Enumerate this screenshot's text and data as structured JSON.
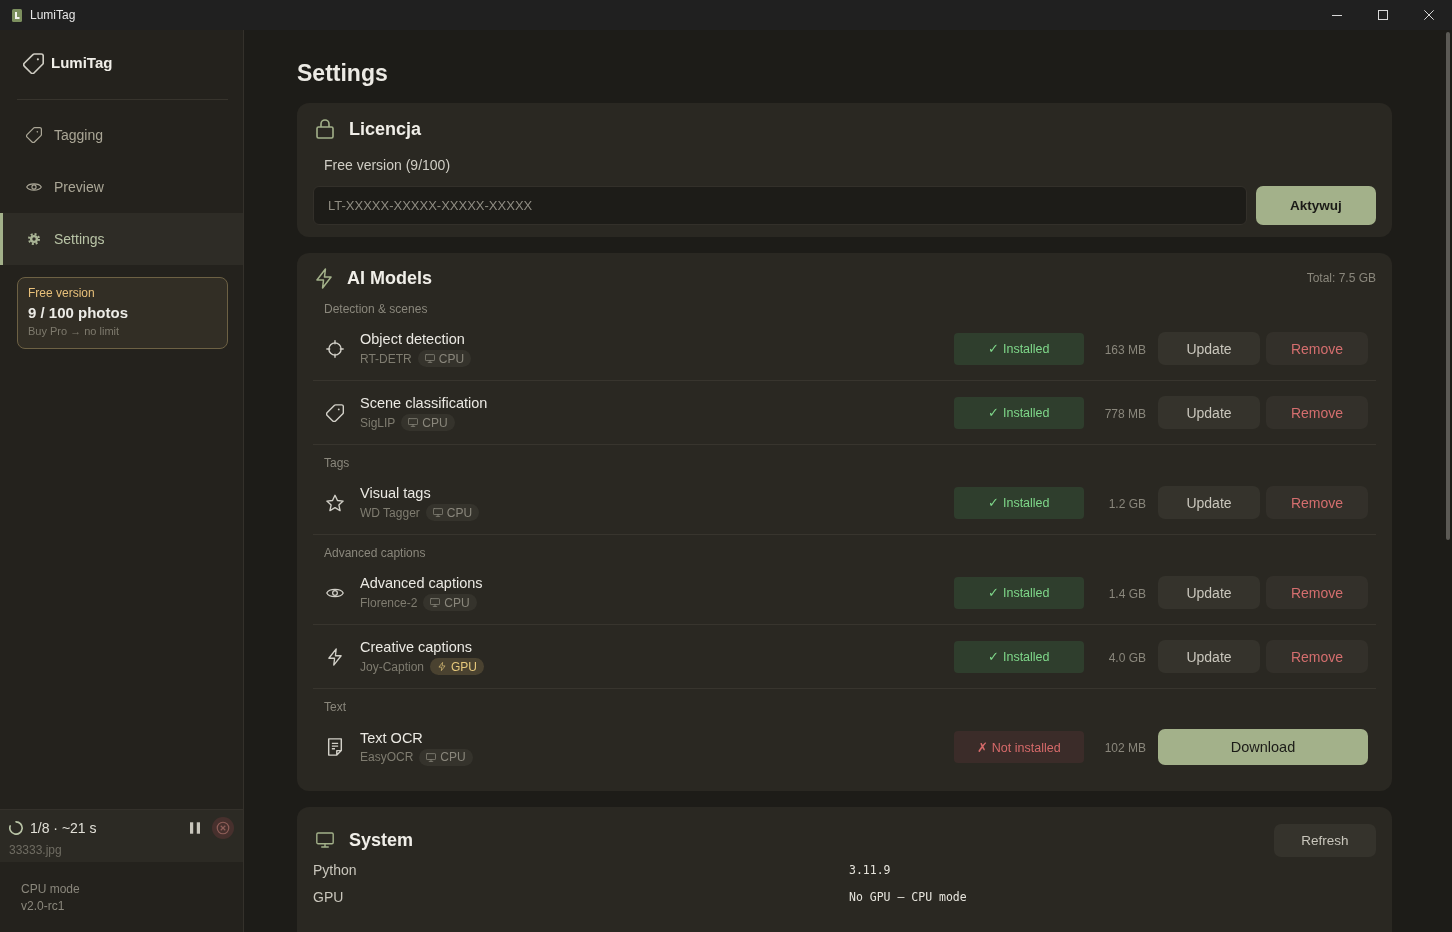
{
  "window": {
    "title": "LumiTag"
  },
  "sidebar": {
    "brand": "LumiTag",
    "items": [
      {
        "label": "Tagging",
        "selected": false
      },
      {
        "label": "Preview",
        "selected": false
      },
      {
        "label": "Settings",
        "selected": true
      }
    ],
    "plan_card": {
      "title": "Free version",
      "usage": "9 / 100 photos",
      "hint": "Buy Pro → no limit"
    },
    "job": {
      "running": true,
      "progress": "1/8 · ~21 s",
      "file": "33333.jpg"
    },
    "footer": {
      "mode": "CPU mode",
      "version": "v2.0-rc1"
    }
  },
  "page": {
    "title": "Settings"
  },
  "license": {
    "title": "Licencja",
    "status": "Free version (9/100)",
    "key_field": {
      "placeholder": "LT-XXXXX-XXXXX-XXXXX-XXXXX"
    },
    "button": "Aktywuj"
  },
  "models": {
    "title": "AI Models",
    "total": "Total: 7.5 GB",
    "groups": [
      {
        "label": "Detection & scenes",
        "items": [
          {
            "name": "Object detection",
            "model": "RT-DETR",
            "device": {
              "label": "CPU",
              "kind": "cpu"
            },
            "installed": true,
            "status": "✓ Installed",
            "size": "163 MB",
            "actions": [
              {
                "label": "Update",
                "kind": "update"
              },
              {
                "label": "Remove",
                "kind": "remove"
              }
            ]
          },
          {
            "name": "Scene classification",
            "model": "SigLIP",
            "device": {
              "label": "CPU",
              "kind": "cpu"
            },
            "installed": true,
            "status": "✓ Installed",
            "size": "778 MB",
            "actions": [
              {
                "label": "Update",
                "kind": "update"
              },
              {
                "label": "Remove",
                "kind": "remove"
              }
            ]
          }
        ]
      },
      {
        "label": "Tags",
        "items": [
          {
            "name": "Visual tags",
            "model": "WD Tagger",
            "device": {
              "label": "CPU",
              "kind": "cpu"
            },
            "installed": true,
            "status": "✓ Installed",
            "size": "1.2 GB",
            "actions": [
              {
                "label": "Update",
                "kind": "update"
              },
              {
                "label": "Remove",
                "kind": "remove"
              }
            ]
          }
        ]
      },
      {
        "label": "Advanced captions",
        "items": [
          {
            "name": "Advanced captions",
            "model": "Florence-2",
            "device": {
              "label": "CPU",
              "kind": "cpu"
            },
            "installed": true,
            "status": "✓ Installed",
            "size": "1.4 GB",
            "actions": [
              {
                "label": "Update",
                "kind": "update"
              },
              {
                "label": "Remove",
                "kind": "remove"
              }
            ]
          },
          {
            "name": "Creative captions",
            "model": "Joy-Caption",
            "device": {
              "label": "GPU",
              "kind": "gpu"
            },
            "installed": true,
            "status": "✓ Installed",
            "size": "4.0 GB",
            "actions": [
              {
                "label": "Update",
                "kind": "update"
              },
              {
                "label": "Remove",
                "kind": "remove"
              }
            ]
          }
        ]
      },
      {
        "label": "Text",
        "items": [
          {
            "name": "Text OCR",
            "model": "EasyOCR",
            "device": {
              "label": "CPU",
              "kind": "cpu"
            },
            "installed": false,
            "status": "✗ Not installed",
            "size": "102 MB",
            "actions": [
              {
                "label": "Download",
                "kind": "download"
              }
            ]
          }
        ]
      }
    ]
  },
  "system": {
    "title": "System",
    "button": "Refresh",
    "rows": [
      {
        "label": "Python",
        "value": "3.11.9"
      },
      {
        "label": "GPU",
        "value": "No GPU — CPU mode"
      }
    ]
  }
}
